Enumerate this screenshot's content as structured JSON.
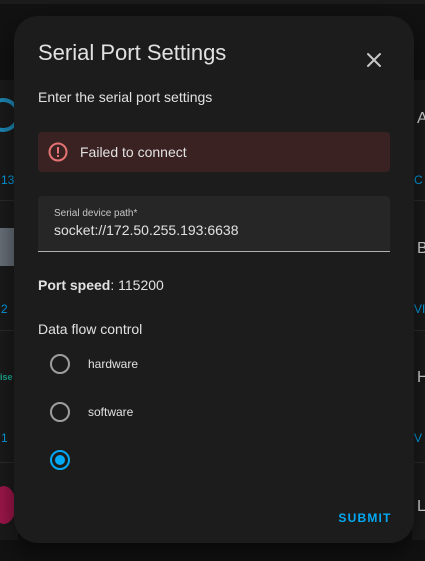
{
  "dialog": {
    "title": "Serial Port Settings",
    "subtitle": "Enter the serial port settings",
    "close_icon": "close-icon"
  },
  "alert": {
    "icon": "error-circle-icon",
    "text": "Failed to connect",
    "color": "#e57373"
  },
  "serial_path": {
    "label": "Serial device path*",
    "value": "socket://172.50.255.193:6638"
  },
  "port_speed": {
    "label": "Port speed",
    "value": "115200"
  },
  "flow_control": {
    "label": "Data flow control",
    "options": [
      {
        "label": "hardware",
        "selected": false
      },
      {
        "label": "software",
        "selected": false
      },
      {
        "label": "",
        "selected": true
      }
    ]
  },
  "submit": {
    "label": "SUBMIT"
  },
  "background": {
    "left_links": [
      "13",
      "2",
      "1"
    ],
    "right_links": [
      "C",
      "VI",
      "V"
    ],
    "right_letters": [
      "A",
      "B",
      "H",
      "L"
    ],
    "left_logo_text": "ise"
  },
  "colors": {
    "accent": "#03a9f4",
    "dialog_bg": "#1c1c1c",
    "text": "#e1e1e1",
    "alert_bg": "#3a2222"
  }
}
